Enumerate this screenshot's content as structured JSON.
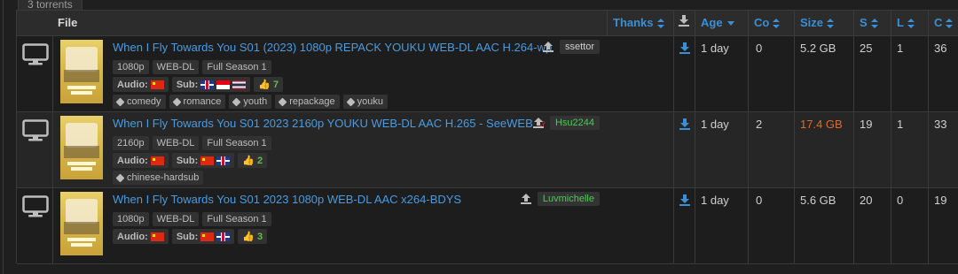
{
  "count_label": "3 torrents",
  "header": {
    "file": "File",
    "thanks": "Thanks",
    "age": "Age",
    "comments": "Co",
    "size": "Size",
    "seeders": "S",
    "leechers": "L",
    "completed": "C"
  },
  "rows": [
    {
      "title": "When I Fly Towards You S01 (2023) 1080p REPACK YOUKU WEB-DL AAC H.264-wp",
      "tags": [
        "1080p",
        "WEB-DL",
        "Full Season 1"
      ],
      "audio_label": "Audio:",
      "sub_label": "Sub:",
      "thanks_count": "7",
      "keywords": [
        "comedy",
        "romance",
        "youth",
        "repackage",
        "youku"
      ],
      "uploader": "ssettor",
      "uploader_color": "#cfcfcf",
      "age": "1 day",
      "comments": "0",
      "size": "5.2 GB",
      "size_color": "#cfcfcf",
      "seeders": "25",
      "leechers": "1",
      "completed": "36"
    },
    {
      "title": "When I Fly Towards You S01 2023 2160p YOUKU WEB-DL AAC H.265 - SeeWEB",
      "tags": [
        "2160p",
        "WEB-DL",
        "Full Season 1"
      ],
      "audio_label": "Audio:",
      "sub_label": "Sub:",
      "thanks_count": "2",
      "keywords": [
        "chinese-hardsub"
      ],
      "uploader": "Hsu2244",
      "uploader_color": "#4fc85a",
      "age": "1 day",
      "comments": "2",
      "size": "17.4 GB",
      "size_color": "#e06a2e",
      "seeders": "19",
      "leechers": "1",
      "completed": "33"
    },
    {
      "title": "When I Fly Towards You S01 2023 1080p WEB-DL AAC x264-BDYS",
      "tags": [
        "1080p",
        "WEB-DL",
        "Full Season 1"
      ],
      "audio_label": "Audio:",
      "sub_label": "Sub:",
      "thanks_count": "3",
      "keywords": [],
      "uploader": "Luvmichelle",
      "uploader_color": "#4fc85a",
      "age": "1 day",
      "comments": "0",
      "size": "5.6 GB",
      "size_color": "#cfcfcf",
      "seeders": "20",
      "leechers": "0",
      "completed": "19"
    }
  ],
  "colors": {
    "link": "#3a8fd6",
    "background": "#1f1f1f"
  }
}
